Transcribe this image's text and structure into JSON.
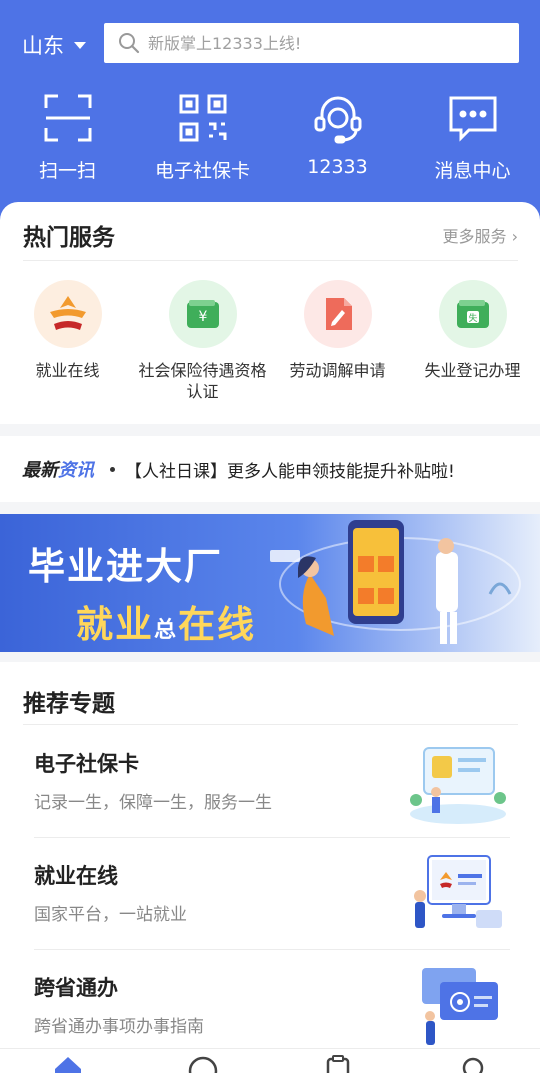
{
  "header": {
    "region": "山东",
    "search_placeholder": "新版掌上12333上线!",
    "quick": [
      {
        "label": "扫一扫",
        "icon": "scan-icon"
      },
      {
        "label": "电子社保卡",
        "icon": "qr-code-icon"
      },
      {
        "label": "12333",
        "icon": "headset-icon"
      },
      {
        "label": "消息中心",
        "icon": "message-icon"
      }
    ]
  },
  "hot": {
    "title": "热门服务",
    "more": "更多服务",
    "items": [
      {
        "label": "就业在线",
        "icon": "employment-logo-icon",
        "bg": "#fdeee0"
      },
      {
        "label": "社会保险待遇资格认证",
        "icon": "wallet-yuan-icon",
        "bg": "#e3f6e6"
      },
      {
        "label": "劳动调解申请",
        "icon": "document-pen-icon",
        "bg": "#fde8e6"
      },
      {
        "label": "失业登记办理",
        "icon": "wallet-stamp-icon",
        "bg": "#e3f6e6"
      }
    ]
  },
  "news": {
    "tag_a": "最新",
    "tag_b": "资讯",
    "text": "【人社日课】更多人能申领技能提升补贴啦!"
  },
  "banner": {
    "line1": "毕业进大厂",
    "line2a": "就业",
    "line2b": "总",
    "line2c": "在线"
  },
  "recommend": {
    "title": "推荐专题",
    "items": [
      {
        "title": "电子社保卡",
        "sub": "记录一生，保障一生，服务一生",
        "pic": "social-card-illustration-icon"
      },
      {
        "title": "就业在线",
        "sub": "国家平台，一站就业",
        "pic": "employment-screen-illustration-icon"
      },
      {
        "title": "跨省通办",
        "sub": "跨省通办事项办事指南",
        "pic": "cross-province-illustration-icon"
      }
    ]
  },
  "colors": {
    "primary": "#4e73e6",
    "accent_yellow": "#ffd75a"
  }
}
